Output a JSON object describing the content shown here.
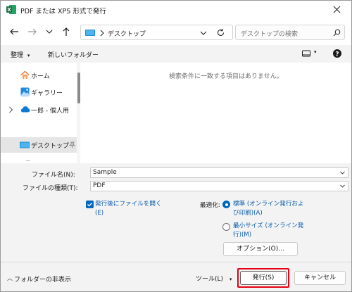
{
  "window": {
    "title": "PDF または XPS 形式で発行"
  },
  "nav": {
    "address_path": "デスクトップ",
    "search_placeholder": "デスクトップの検索"
  },
  "commands": {
    "organize": "整理",
    "new_folder": "新しいフォルダー"
  },
  "sidebar": {
    "items": [
      {
        "label": "ホーム",
        "icon": "home-icon"
      },
      {
        "label": "ギャラリー",
        "icon": "gallery-icon"
      },
      {
        "label": "一郎 - 個人用",
        "icon": "onedrive-cloud-icon"
      },
      {
        "label": "デスクトップ",
        "icon": "desktop-folder-icon",
        "selected": true
      }
    ]
  },
  "file_list": {
    "empty_message": "検索条件に一致する項目はありません。"
  },
  "form": {
    "filename_label": "ファイル名(N):",
    "filename_value": "Sample",
    "filetype_label": "ファイルの種類(T):",
    "filetype_value": "PDF"
  },
  "options": {
    "open_after_publish_line1": "発行後にファイルを開く",
    "open_after_publish_line2": "(E)",
    "open_after_publish_checked": true,
    "optimize_label": "最適化:",
    "standard_line1": "標準 (オンライン発行およ",
    "standard_line2": "び印刷)(A)",
    "standard_selected": true,
    "minimum_line1": "最小サイズ (オンライン発",
    "minimum_line2": "行)(M)",
    "options_button": "オプション(O)..."
  },
  "footer": {
    "hide_folders": "フォルダーの非表示",
    "tools": "ツール(L)",
    "publish": "発行(S)",
    "cancel": "キャンセル"
  },
  "colors": {
    "accent": "#0067c0",
    "highlight": "#e60012",
    "excel_green": "#1d6f42"
  }
}
